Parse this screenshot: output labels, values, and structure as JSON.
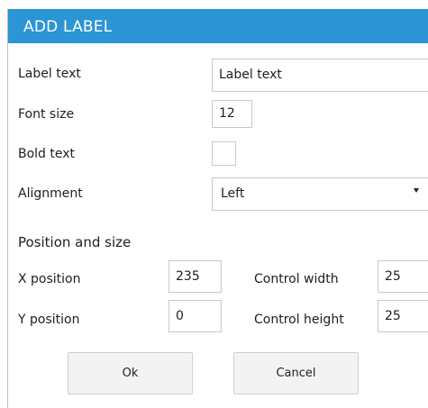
{
  "dialog": {
    "title": "ADD LABEL"
  },
  "fields": {
    "label_text": {
      "label": "Label text",
      "value": "Label text"
    },
    "font_size": {
      "label": "Font size",
      "value": "12"
    },
    "bold_text": {
      "label": "Bold text",
      "checked": false
    },
    "alignment": {
      "label": "Alignment",
      "value": "Left"
    }
  },
  "section": {
    "title": "Position and size"
  },
  "position": {
    "x": {
      "label": "X position",
      "value": "235"
    },
    "y": {
      "label": "Y position",
      "value": "0"
    },
    "width": {
      "label": "Control width",
      "value": "25"
    },
    "height": {
      "label": "Control height",
      "value": "25"
    }
  },
  "buttons": {
    "ok": "Ok",
    "cancel": "Cancel"
  },
  "colors": {
    "titlebar": "#2b95d5",
    "title_text": "#ffffff"
  }
}
